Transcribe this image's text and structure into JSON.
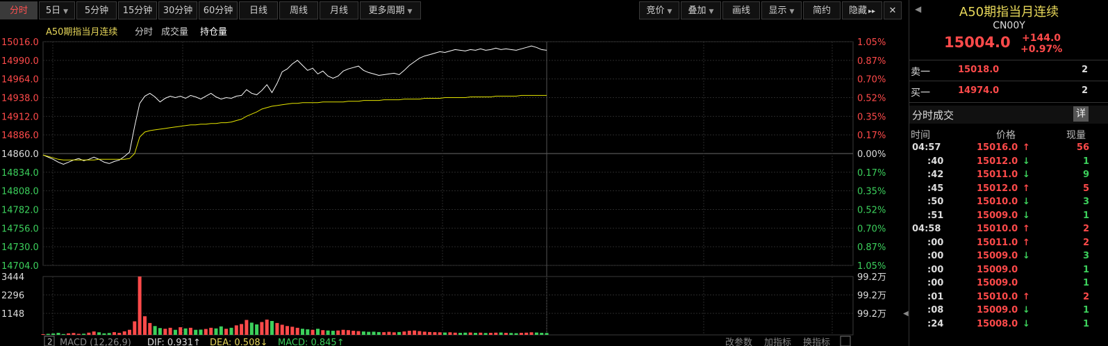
{
  "toolbar": {
    "left": [
      {
        "label": "分时",
        "active": true,
        "caret": false
      },
      {
        "label": "5日",
        "caret": true
      },
      {
        "label": "5分钟",
        "caret": false
      },
      {
        "label": "15分钟",
        "caret": false
      },
      {
        "label": "30分钟",
        "caret": false
      },
      {
        "label": "60分钟",
        "caret": false
      },
      {
        "label": "日线",
        "caret": false
      },
      {
        "label": "周线",
        "caret": false
      },
      {
        "label": "月线",
        "caret": false
      },
      {
        "label": "更多周期",
        "caret": true
      }
    ],
    "right": [
      {
        "label": "竞价",
        "caret": true
      },
      {
        "label": "叠加",
        "caret": true
      },
      {
        "label": "画线",
        "caret": false
      },
      {
        "label": "显示",
        "caret": true
      },
      {
        "label": "简约",
        "caret": false
      },
      {
        "label": "隐藏",
        "caret": false,
        "suffix": "▸▸"
      }
    ],
    "close_icon": "✕"
  },
  "chart_header": {
    "name": "A50期指当月连续",
    "items": [
      "分时",
      "成交量",
      "持仓量"
    ]
  },
  "price_axis": {
    "labels": [
      "15016.0",
      "14990.0",
      "14964.0",
      "14938.0",
      "14912.0",
      "14886.0",
      "14860.0",
      "14834.0",
      "14808.0",
      "14782.0",
      "14756.0",
      "14730.0",
      "14704.0"
    ],
    "pct": [
      "1.05%",
      "0.87%",
      "0.70%",
      "0.52%",
      "0.35%",
      "0.17%",
      "0.00%",
      "0.17%",
      "0.35%",
      "0.52%",
      "0.70%",
      "0.87%",
      "1.05%"
    ]
  },
  "volume_axis": {
    "labels": [
      "3444",
      "2296",
      "1148"
    ],
    "right": [
      "99.2万",
      "99.2万",
      "99.2万"
    ]
  },
  "indicator_bar": {
    "index": "2",
    "name": "MACD (12,26,9)",
    "dif": "DIF: 0.931↑",
    "dea": "DEA: 0.508↓",
    "macd": "MACD: 0.845↑",
    "buttons": [
      "改参数",
      "加指标",
      "换指标"
    ]
  },
  "colors": {
    "up": "#ff4a4a",
    "down": "#3cd05c",
    "price_line": "#ffffff",
    "avg_line": "#e6e600",
    "grid": "#2a2a2a",
    "border": "#3a3a3a"
  },
  "chart_data": {
    "type": "line",
    "prev_close": 14860.0,
    "ylim": [
      14704.0,
      15016.0
    ],
    "series": [
      {
        "values": [
          14858,
          14855,
          14852,
          14848,
          14845,
          14848,
          14851,
          14853,
          14850,
          14852,
          14855,
          14852,
          14848,
          14846,
          14849,
          14851,
          14856,
          14862,
          14898,
          14930,
          14940,
          14944,
          14939,
          14932,
          14937,
          14940,
          14938,
          14940,
          14937,
          14941,
          14939,
          14936,
          14940,
          14944,
          14939,
          14936,
          14938,
          14937,
          14940,
          14941,
          14949,
          14944,
          14942,
          14948,
          14956,
          14945,
          14958,
          14974,
          14978,
          14985,
          14990,
          14983,
          14976,
          14979,
          14971,
          14975,
          14968,
          14965,
          14968,
          14975,
          14978,
          14980,
          14982,
          14976,
          14973,
          14971,
          14969,
          14970,
          14971,
          14972,
          14970,
          14976,
          14983,
          14988,
          14993,
          14996,
          14998,
          15000,
          15002,
          15001,
          15003,
          15005,
          15004,
          15003,
          15005,
          15004,
          15006,
          15004,
          15005,
          15007,
          15005,
          15006,
          15005,
          15004,
          15006,
          15008,
          15010,
          15008,
          15005,
          15004
        ]
      },
      {
        "values": [
          14858,
          14856,
          14854,
          14852,
          14851,
          14851,
          14851,
          14851,
          14851,
          14851,
          14851,
          14852,
          14852,
          14852,
          14852,
          14852,
          14852,
          14853,
          14860,
          14883,
          14890,
          14892,
          14893,
          14894,
          14895,
          14896,
          14897,
          14898,
          14899,
          14900,
          14900,
          14901,
          14901,
          14902,
          14902,
          14903,
          14903,
          14904,
          14906,
          14908,
          14912,
          14915,
          14918,
          14922,
          14924,
          14926,
          14927,
          14928,
          14929,
          14930,
          14930,
          14931,
          14931,
          14931,
          14931,
          14932,
          14932,
          14932,
          14932,
          14932,
          14933,
          14933,
          14933,
          14934,
          14934,
          14934,
          14934,
          14935,
          14935,
          14935,
          14935,
          14936,
          14936,
          14936,
          14936,
          14937,
          14937,
          14937,
          14937,
          14938,
          14938,
          14938,
          14938,
          14938,
          14939,
          14939,
          14939,
          14939,
          14939,
          14940,
          14940,
          14940,
          14940,
          14940,
          14941,
          14941,
          14941,
          14941,
          14941,
          14941
        ]
      }
    ],
    "volume_ylim": [
      0,
      3444
    ],
    "volume": [
      40,
      60,
      80,
      120,
      50,
      90,
      110,
      60,
      70,
      130,
      200,
      150,
      90,
      110,
      160,
      120,
      210,
      300,
      800,
      3444,
      1100,
      700,
      520,
      400,
      360,
      420,
      300,
      450,
      380,
      420,
      300,
      310,
      350,
      420,
      380,
      500,
      360,
      420,
      560,
      640,
      880,
      720,
      620,
      760,
      900,
      820,
      700,
      600,
      520,
      480,
      420,
      360,
      330,
      300,
      360,
      280,
      260,
      240,
      260,
      300,
      280,
      240,
      220,
      200,
      180,
      190,
      170,
      160,
      180,
      150,
      170,
      200,
      240,
      260,
      220,
      190,
      170,
      160,
      150,
      140,
      150,
      130,
      120,
      130,
      140,
      120,
      130,
      110,
      120,
      130,
      140,
      120,
      110,
      100,
      120,
      130,
      150,
      140,
      120,
      110
    ]
  },
  "quote": {
    "name": "A50期指当月连续",
    "code": "CN00Y",
    "price": "15004.0",
    "change": "+144.0",
    "change_pct": "+0.97%",
    "sell_label": "卖一",
    "sell_price": "15018.0",
    "sell_qty": "2",
    "buy_label": "买一",
    "buy_price": "14974.0",
    "buy_qty": "2",
    "ticks_title": "分时成交",
    "detail_btn": "详",
    "col_time": "时间",
    "col_price": "价格",
    "col_vol": "现量",
    "ticks": [
      {
        "time": "04:57",
        "price": "15016.0",
        "dir": "↑",
        "vol": "56",
        "dc": "red",
        "bold_time": true
      },
      {
        "time": ":40",
        "price": "15012.0",
        "dir": "↓",
        "vol": "1",
        "dc": "green"
      },
      {
        "time": ":42",
        "price": "15011.0",
        "dir": "↓",
        "vol": "9",
        "dc": "green"
      },
      {
        "time": ":45",
        "price": "15012.0",
        "dir": "↑",
        "vol": "5",
        "dc": "red"
      },
      {
        "time": ":50",
        "price": "15010.0",
        "dir": "↓",
        "vol": "3",
        "dc": "green"
      },
      {
        "time": ":51",
        "price": "15009.0",
        "dir": "↓",
        "vol": "1",
        "dc": "green"
      },
      {
        "time": "04:58",
        "price": "15010.0",
        "dir": "↑",
        "vol": "2",
        "dc": "red",
        "bold_time": true
      },
      {
        "time": ":00",
        "price": "15011.0",
        "dir": "↑",
        "vol": "2",
        "dc": "red"
      },
      {
        "time": ":00",
        "price": "15009.0",
        "dir": "↓",
        "vol": "3",
        "dc": "green"
      },
      {
        "time": ":00",
        "price": "15009.0",
        "dir": "",
        "vol": "1",
        "dc": "green"
      },
      {
        "time": ":00",
        "price": "15009.0",
        "dir": "",
        "vol": "1",
        "dc": "green"
      },
      {
        "time": ":01",
        "price": "15010.0",
        "dir": "↑",
        "vol": "2",
        "dc": "red"
      },
      {
        "time": ":08",
        "price": "15009.0",
        "dir": "↓",
        "vol": "1",
        "dc": "green"
      },
      {
        "time": ":24",
        "price": "15008.0",
        "dir": "↓",
        "vol": "1",
        "dc": "green"
      }
    ]
  }
}
